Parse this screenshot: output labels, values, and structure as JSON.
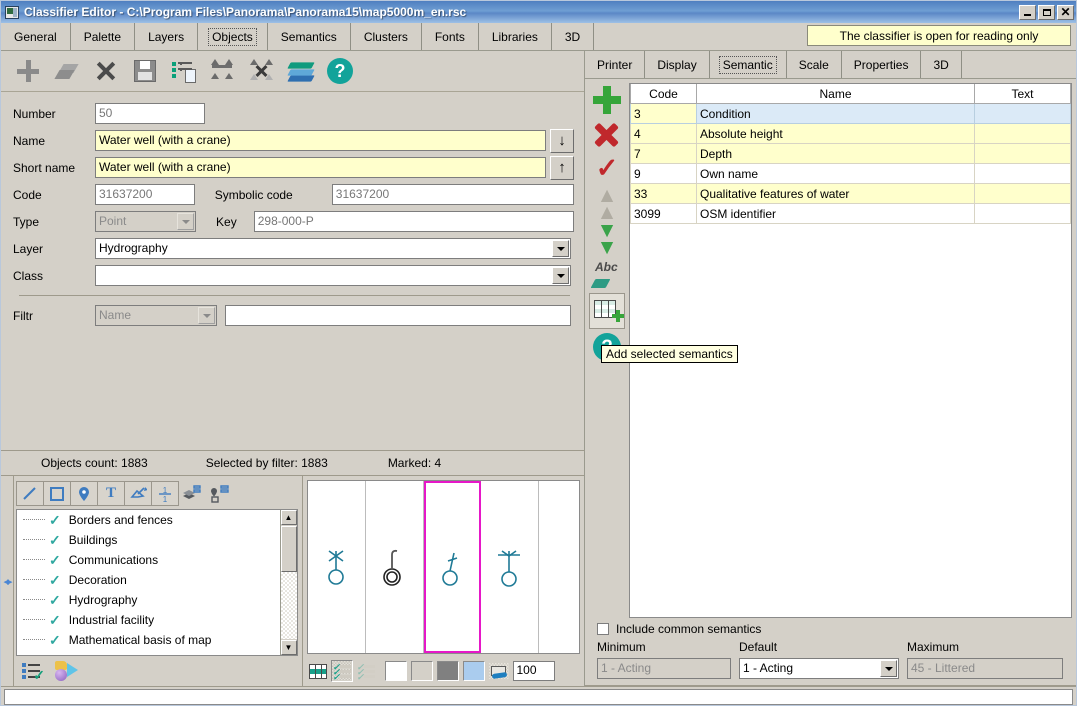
{
  "window": {
    "title": "Classifier Editor - C:\\Program Files\\Panorama\\Panorama15\\map5000m_en.rsc",
    "icon": "app-icon",
    "minimize": "_",
    "maximize": "□",
    "close": "✕"
  },
  "main_tabs": [
    {
      "label": "General",
      "selected": false
    },
    {
      "label": "Palette",
      "selected": false
    },
    {
      "label": "Layers",
      "selected": false
    },
    {
      "label": "Objects",
      "selected": true
    },
    {
      "label": "Semantics",
      "selected": false
    },
    {
      "label": "Clusters",
      "selected": false
    },
    {
      "label": "Fonts",
      "selected": false
    },
    {
      "label": "Libraries",
      "selected": false
    },
    {
      "label": "3D",
      "selected": false
    }
  ],
  "readonly_notice": "The classifier is open for reading only",
  "object_toolbar": [
    {
      "name": "add-object-icon"
    },
    {
      "name": "copy-object-icon"
    },
    {
      "name": "delete-object-icon"
    },
    {
      "name": "save-object-icon"
    },
    {
      "name": "list-object-icon"
    },
    {
      "name": "move-objects-icon"
    },
    {
      "name": "delete-objects-icon"
    },
    {
      "name": "layers-icon"
    },
    {
      "name": "help-icon"
    }
  ],
  "form": {
    "number": {
      "label": "Number",
      "value": "50"
    },
    "name": {
      "label": "Name",
      "value": "Water well (with a crane)"
    },
    "short_name": {
      "label": "Short name",
      "value": "Water well (with a crane)"
    },
    "code": {
      "label": "Code",
      "value": "31637200"
    },
    "symbolic_code": {
      "label": "Symbolic code",
      "value": "31637200"
    },
    "type": {
      "label": "Type",
      "value": "Point"
    },
    "key": {
      "label": "Key",
      "value": "298-000-P"
    },
    "layer": {
      "label": "Layer",
      "value": "Hydrography"
    },
    "class": {
      "label": "Class",
      "value": ""
    },
    "filtr": {
      "label": "Filtr",
      "field": "Name",
      "value": ""
    },
    "down_button": "↓",
    "up_button": "↑"
  },
  "status": {
    "objects_count": "Objects count: 1883",
    "selected_by_filter": "Selected by filter: 1883",
    "marked": "Marked: 4"
  },
  "shape_toolbar": [
    {
      "name": "line-tool-icon",
      "glyph": "╱"
    },
    {
      "name": "rectangle-tool-icon",
      "glyph": "□"
    },
    {
      "name": "point-tool-icon",
      "glyph": "◉"
    },
    {
      "name": "text-tool-icon",
      "glyph": "T"
    },
    {
      "name": "vector-tool-icon",
      "glyph": "↗"
    },
    {
      "name": "fraction-tool-icon",
      "glyph": "½"
    },
    {
      "name": "layers-tool-icon",
      "glyph": "≡"
    },
    {
      "name": "point-template-tool-icon",
      "glyph": "◎"
    }
  ],
  "tree": {
    "items": [
      {
        "label": "Borders and fences"
      },
      {
        "label": "Buildings"
      },
      {
        "label": "Communications"
      },
      {
        "label": "Decoration"
      },
      {
        "label": "Hydrography"
      },
      {
        "label": "Industrial facility"
      },
      {
        "label": "Mathematical basis of map"
      }
    ],
    "scroll_up": "▲",
    "scroll_down": "▼"
  },
  "tree_footer": [
    {
      "name": "list-check-icon"
    },
    {
      "name": "palette-icon"
    }
  ],
  "symbols": {
    "cells": [
      {
        "name": "symbol-well-star",
        "selected": false
      },
      {
        "name": "symbol-well-double-circle",
        "selected": false
      },
      {
        "name": "symbol-well-with-crane",
        "selected": true
      },
      {
        "name": "symbol-well-with-mast",
        "selected": false
      }
    ],
    "color": "#1f7a96"
  },
  "symbol_footer": {
    "buttons": [
      {
        "name": "grid-view-button",
        "pressed": false
      },
      {
        "name": "checklist-view-button",
        "pressed": true
      },
      {
        "name": "filter-view-button",
        "pressed": false,
        "disabled": true
      }
    ],
    "swatches": [
      "#ffffff",
      "#d4d0c8",
      "#808080",
      "#aaccee"
    ],
    "pen_button": "pen-button",
    "zoom_value": "100"
  },
  "right_tabs": [
    {
      "label": "Printer",
      "selected": false
    },
    {
      "label": "Display",
      "selected": false
    },
    {
      "label": "Semantic",
      "selected": true
    },
    {
      "label": "Scale",
      "selected": false
    },
    {
      "label": "Properties",
      "selected": false
    },
    {
      "label": "3D",
      "selected": false
    }
  ],
  "semantic_toolbar": [
    {
      "name": "add-semantic-icon",
      "framed": false
    },
    {
      "name": "delete-semantic-icon",
      "framed": false
    },
    {
      "name": "apply-semantic-icon",
      "framed": false
    },
    {
      "name": "move-up-semantic-icon",
      "framed": false
    },
    {
      "name": "move-down-semantic-icon",
      "framed": false
    },
    {
      "name": "rename-semantic-icon",
      "framed": false
    },
    {
      "name": "add-selected-semantics-icon",
      "framed": true
    },
    {
      "name": "semantic-help-icon",
      "framed": false
    }
  ],
  "tooltip": "Add selected semantics",
  "semantic_table": {
    "columns": [
      "Code",
      "Name",
      "Text"
    ],
    "rows": [
      {
        "code": "3",
        "name": "Condition",
        "text": "",
        "state": "selected"
      },
      {
        "code": "4",
        "name": "Absolute height",
        "text": "",
        "state": "yellow"
      },
      {
        "code": "7",
        "name": "Depth",
        "text": "",
        "state": "yellow"
      },
      {
        "code": "9",
        "name": "Own name",
        "text": "",
        "state": "white"
      },
      {
        "code": "33",
        "name": "Qualitative features of water",
        "text": "",
        "state": "yellow"
      },
      {
        "code": "3099",
        "name": "OSM identifier",
        "text": "",
        "state": "white"
      }
    ]
  },
  "include_common": {
    "label": "Include common semantics",
    "checked": false
  },
  "ranges": {
    "minimum": {
      "label": "Minimum",
      "value": "1 - Acting"
    },
    "default": {
      "label": "Default",
      "value": "1 - Acting"
    },
    "maximum": {
      "label": "Maximum",
      "value": "45 - Littered"
    }
  },
  "app_status_text": ""
}
